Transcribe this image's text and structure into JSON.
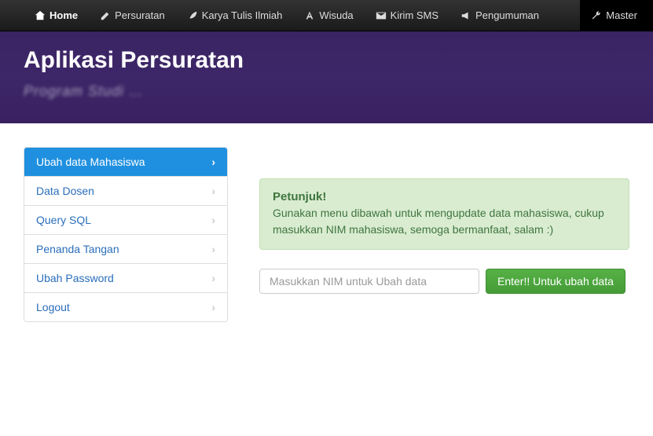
{
  "nav": {
    "items": [
      {
        "label": "Home",
        "icon": "home"
      },
      {
        "label": "Persuratan",
        "icon": "edit"
      },
      {
        "label": "Karya Tulis Ilmiah",
        "icon": "leaf"
      },
      {
        "label": "Wisuda",
        "icon": "font"
      },
      {
        "label": "Kirim SMS",
        "icon": "envelope"
      },
      {
        "label": "Pengumuman",
        "icon": "bullhorn"
      },
      {
        "label": "Master",
        "icon": "wrench"
      }
    ]
  },
  "hero": {
    "title": "Aplikasi Persuratan",
    "subtitle": "Program Studi …"
  },
  "sidebar": {
    "items": [
      {
        "label": "Ubah data Mahasiswa"
      },
      {
        "label": "Data Dosen"
      },
      {
        "label": "Query SQL"
      },
      {
        "label": "Penanda Tangan"
      },
      {
        "label": "Ubah Password"
      },
      {
        "label": "Logout"
      }
    ]
  },
  "alert": {
    "title": "Petunjuk!",
    "body": "Gunakan menu dibawah untuk mengupdate data mahasiswa, cukup masukkan NIM mahasiswa, semoga bermanfaat, salam :)"
  },
  "form": {
    "placeholder": "Masukkan NIM untuk Ubah data",
    "button": "Enter!! Untuk ubah data"
  }
}
